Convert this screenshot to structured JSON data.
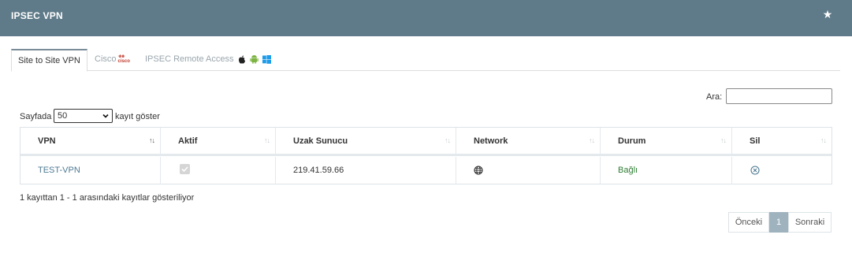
{
  "header": {
    "title": "IPSEC VPN",
    "star_icon": "star-icon"
  },
  "tabs": [
    {
      "label": "Site to Site VPN",
      "active": true
    },
    {
      "label": "Cisco",
      "logo_text": "cisco"
    },
    {
      "label": "IPSEC Remote Access",
      "icons": [
        "apple-icon",
        "android-icon",
        "windows-icon"
      ]
    }
  ],
  "search": {
    "label": "Ara:",
    "value": ""
  },
  "length": {
    "prefix": "Sayfada",
    "value": "50",
    "suffix": "kayıt göster"
  },
  "table": {
    "columns": [
      "VPN",
      "Aktif",
      "Uzak Sunucu",
      "Network",
      "Durum",
      "Sil"
    ],
    "rows": [
      {
        "vpn": "TEST-VPN",
        "aktif": true,
        "uzak_sunucu": "219.41.59.66",
        "network_icon": "globe-icon",
        "durum": "Bağlı",
        "sil_icon": "delete-icon"
      }
    ]
  },
  "info": "1 kayıttan 1 - 1 arasındaki kayıtlar gösteriliyor",
  "pagination": {
    "previous": "Önceki",
    "current": "1",
    "next": "Sonraki"
  },
  "colors": {
    "header_bg": "#5f7a89",
    "link": "#4e7a93",
    "status_ok": "#2e7d32",
    "page_current": "#9fb3bf"
  }
}
